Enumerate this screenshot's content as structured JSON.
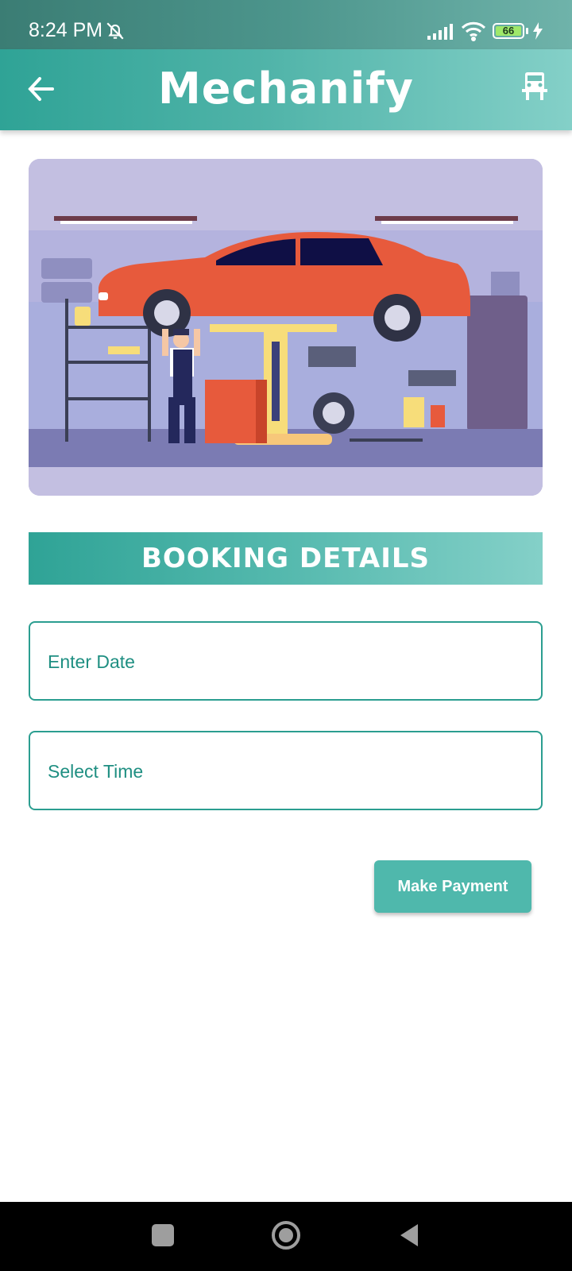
{
  "status_bar": {
    "time": "8:24 PM",
    "battery_level": "66",
    "icons": [
      "bell-off-icon",
      "signal-icon",
      "wifi-icon",
      "battery-icon",
      "charging-icon"
    ]
  },
  "app_bar": {
    "title": "Mechanify",
    "back_icon": "arrow-left-icon",
    "action_icon": "car-icon"
  },
  "hero": {
    "illustration": "mechanic-garage-illustration"
  },
  "booking": {
    "section_title": "BOOKING DETAILS",
    "date_placeholder": "Enter Date",
    "time_placeholder": "Select Time",
    "submit_label": "Make Payment"
  },
  "colors": {
    "primary": "#2fa396",
    "accent": "#4fb8ac",
    "field_border": "#2b9e90"
  },
  "nav": {
    "icons": [
      "recents-icon",
      "home-icon",
      "back-icon"
    ]
  }
}
